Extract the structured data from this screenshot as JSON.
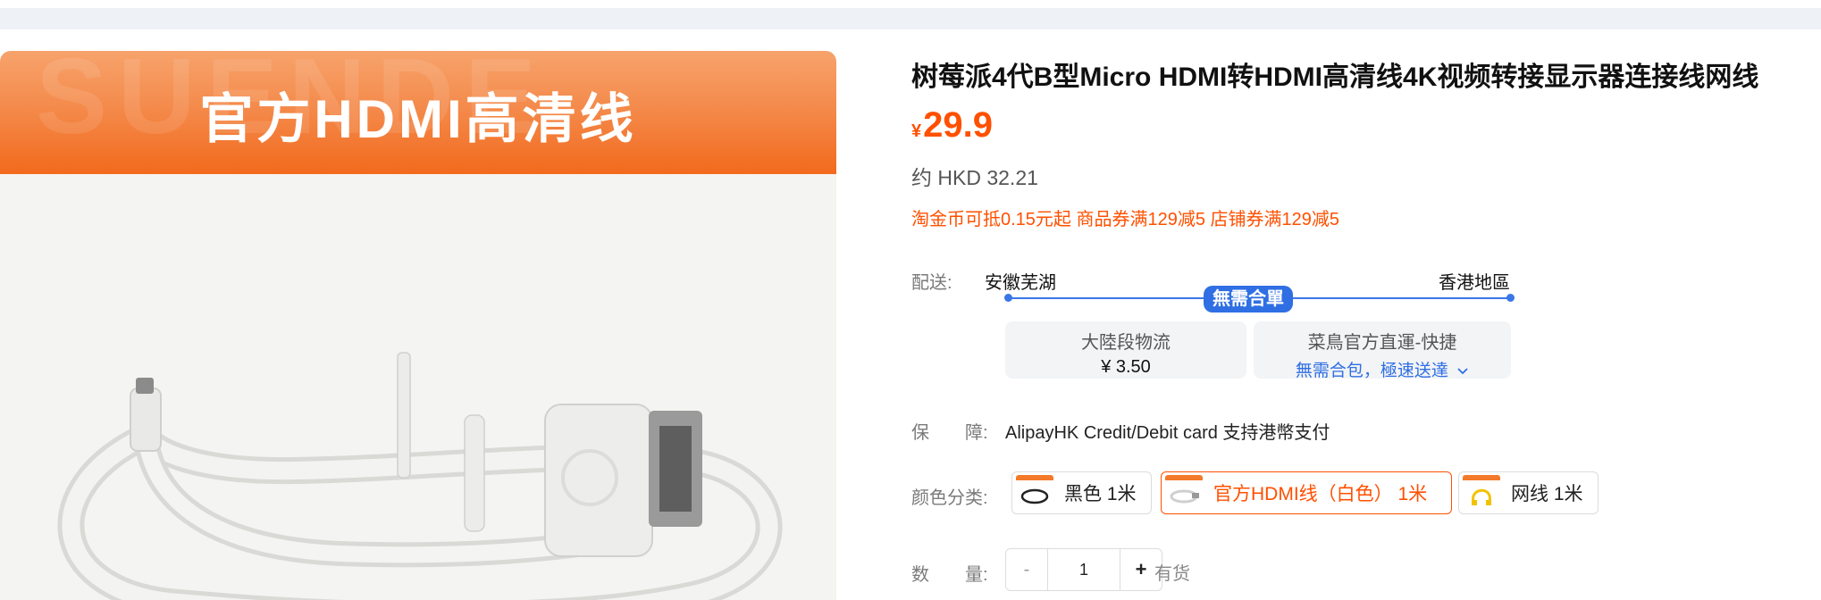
{
  "gallery": {
    "banner_text": "官方HDMI高清线",
    "banner_watermark": "SUENDE",
    "banner_color": "#f26a1d"
  },
  "product": {
    "title": "树莓派4代B型Micro HDMI转HDMI高清线4K视频转接显示器连接线网线",
    "currency": "¥",
    "price": "29.9",
    "hkd": "约 HKD 32.21",
    "promo": "淘金币可抵0.15元起 商品券满129减5 店铺券满129减5",
    "accent_color": "#ff5000"
  },
  "shipping": {
    "label": "配送:",
    "from": "安徽芜湖",
    "to": "香港地區",
    "badge": "無需合單",
    "options": [
      {
        "title": "大陸段物流",
        "detail": "¥ 3.50"
      },
      {
        "title": "菜鳥官方直運-快捷",
        "detail": "無需合包，極速送達",
        "detail_icon": "chevron-down-icon"
      }
    ]
  },
  "guarantee": {
    "label": "保　　障:",
    "text": "AlipayHK Credit/Debit card 支持港幣支付"
  },
  "variants": {
    "label": "颜色分类:",
    "items": [
      {
        "label": "黑色 1米",
        "selected": false,
        "thumb_icon": "black-cable-thumbnail"
      },
      {
        "label": "官方HDMI线（白色） 1米",
        "selected": true,
        "thumb_icon": "white-cable-thumbnail"
      },
      {
        "label": "网线 1米",
        "selected": false,
        "thumb_icon": "yellow-cable-thumbnail"
      }
    ]
  },
  "quantity": {
    "label": "数　　量:",
    "minus": "-",
    "value": "1",
    "plus": "+",
    "stock": "有货"
  }
}
